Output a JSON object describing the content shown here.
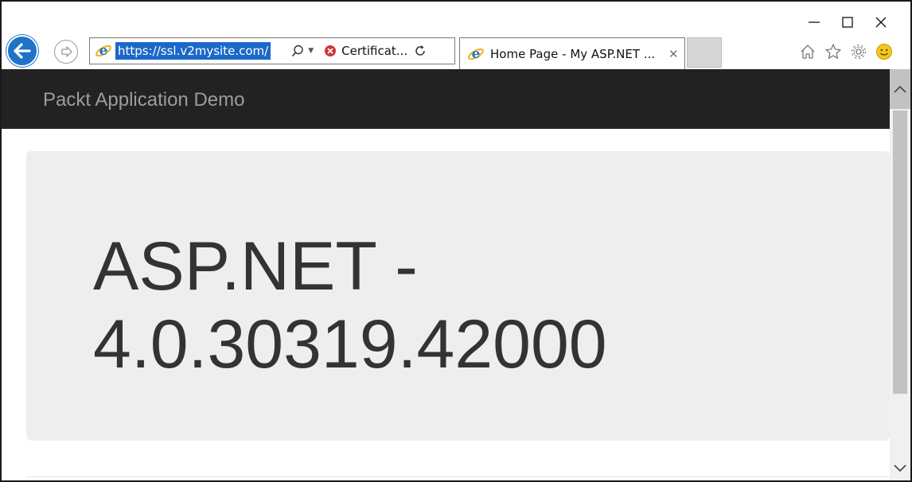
{
  "window": {
    "controls": [
      "minimize-icon",
      "maximize-icon",
      "close-icon"
    ]
  },
  "address_bar": {
    "url": "https://ssl.v2mysite.com/",
    "search_icon": "search-icon",
    "certificate_label": "Certificat...",
    "certificate_status_color": "#d23434",
    "refresh_icon": "refresh-icon"
  },
  "tab": {
    "label": "Home Page - My ASP.NET ...",
    "close_label": "✕"
  },
  "toolbar": {
    "icons": [
      "home-icon",
      "favorites-star-icon",
      "settings-gear-icon",
      "feedback-smiley-icon"
    ]
  },
  "page": {
    "brand": "Packt Application Demo",
    "jumbotron_line1": "ASP.NET -",
    "jumbotron_line2": "4.0.30319.42000"
  },
  "colors": {
    "navbar": "#222222",
    "brand_text": "#9d9d9d",
    "jumbotron_bg": "#eeeeee",
    "accent_blue": "#1e73c8"
  }
}
